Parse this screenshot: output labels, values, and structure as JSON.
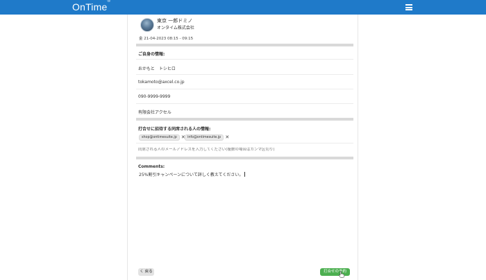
{
  "header": {
    "logo": "OnTime",
    "logo_mark": "®",
    "menu_icon": "hamburger-icon"
  },
  "host": {
    "name": "東京 一郎ドミノ",
    "company": "オンタイム株式会社",
    "datetime": "金 21-04-2023  08:15 - 09:15"
  },
  "your_info": {
    "title": "ご自身の情報:",
    "name": "おかもと　トシヒロ",
    "email": "tokamoto@axcel.co.jp",
    "phone": "090-9999-9999",
    "company": "有限会社アクセル"
  },
  "guests": {
    "title": "打合せに招待する同席される人の情報:",
    "chips": [
      "shop@ontimesuite.jp",
      "info@ontimesuite.jp"
    ],
    "placeholder": "同席される人のメールアドレスを入力してください(複数の場合はカンマ区切り)"
  },
  "comments": {
    "label": "Comments:",
    "text": "25%割引キャンペーンについて詳しく教えてください。"
  },
  "footer": {
    "back_label": "く 戻る",
    "book_label": "打合せの予約"
  },
  "colors": {
    "header_bg": "#1f7ac9",
    "book_button": "#4caf50"
  }
}
